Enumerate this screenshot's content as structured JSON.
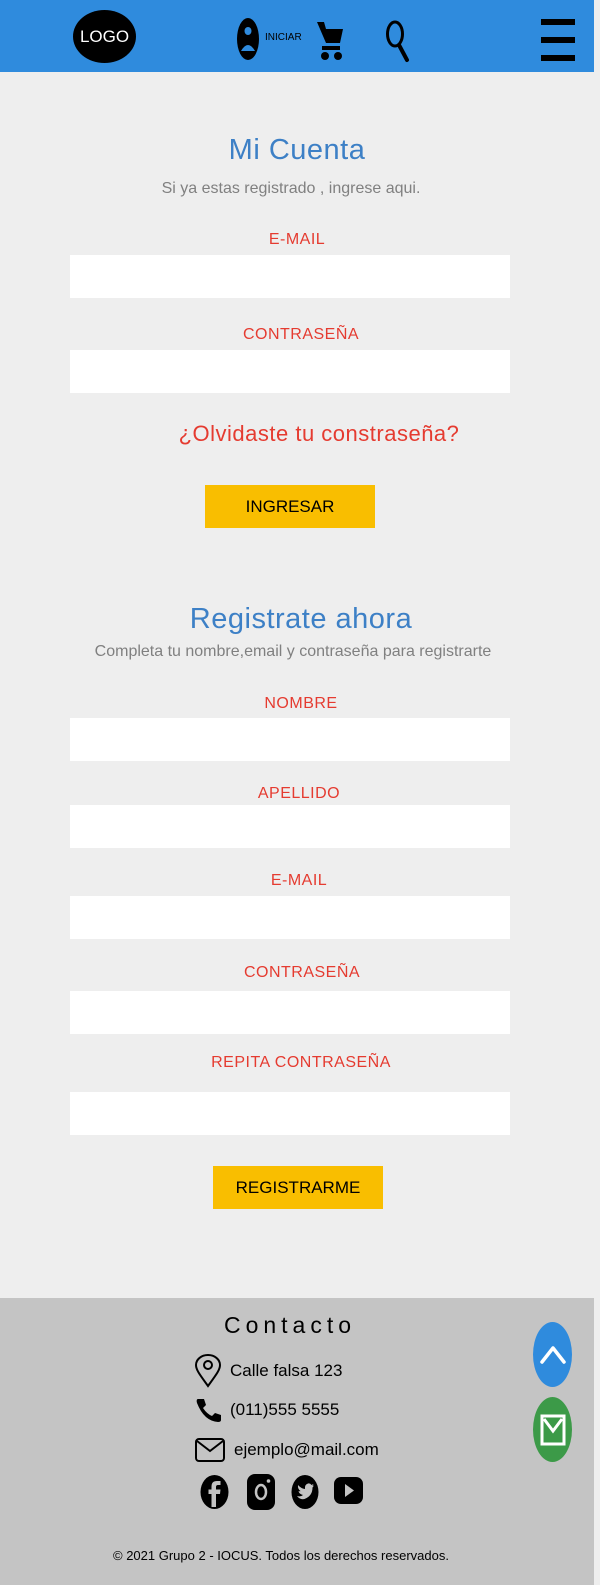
{
  "header": {
    "logo_text": "LOGO",
    "login_label": "INICIAR",
    "icons": [
      "user-icon",
      "cart-icon",
      "search-icon",
      "menu-icon"
    ]
  },
  "login": {
    "title": "Mi Cuenta",
    "subtitle": "Si ya estas registrado , ingrese aqui.",
    "email_label": "E-MAIL",
    "password_label": "CONTRASEÑA",
    "forgot_link": "¿Olvidaste tu constraseña?",
    "submit_label": "INGRESAR"
  },
  "register": {
    "title": "Registrate ahora",
    "subtitle": "Completa tu nombre,email y contraseña para registrarte",
    "name_label": "NOMBRE",
    "lastname_label": "APELLIDO",
    "email_label": "E-MAIL",
    "password_label": "CONTRASEÑA",
    "repeat_password_label": "REPITA CONTRASEÑA",
    "submit_label": "REGISTRARME"
  },
  "footer": {
    "contact_title": "Contacto",
    "address": "Calle falsa 123",
    "phone": "(011)555 5555",
    "email": "ejemplo@mail.com",
    "social_icons": [
      "facebook-icon",
      "instagram-icon",
      "twitter-icon",
      "youtube-icon"
    ],
    "copyright": "© 2021 Grupo 2 - IOCUS. Todos los derechos reservados."
  },
  "colors": {
    "header_bg": "#2f8bdd",
    "page_bg": "#eeeeee",
    "title_blue": "#3d80c6",
    "label_red": "#e53b30",
    "button_yellow": "#f9be00",
    "footer_bg": "#c4c4c4",
    "fab_green": "#3c9a48"
  }
}
